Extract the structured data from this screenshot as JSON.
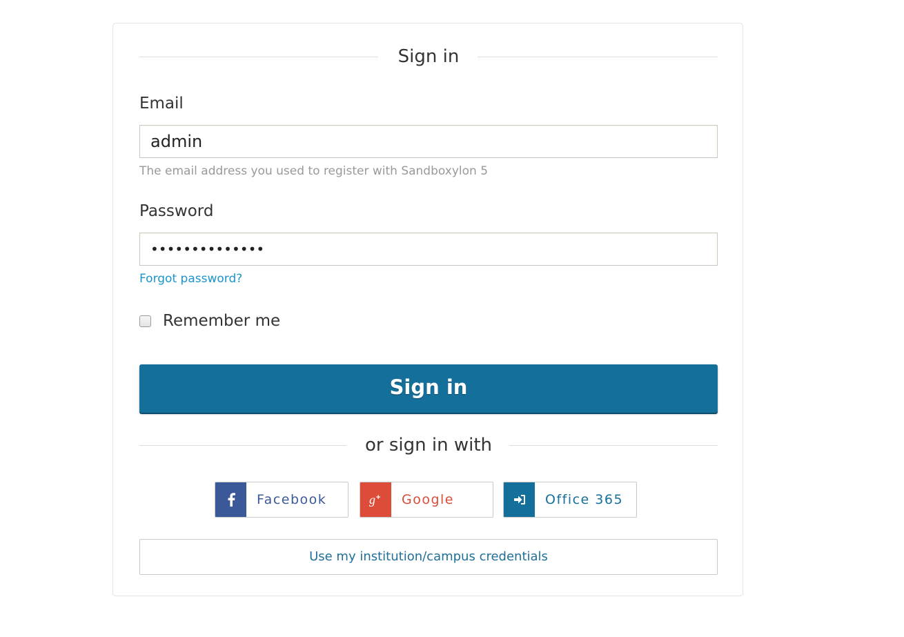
{
  "form": {
    "title": "Sign in",
    "email": {
      "label": "Email",
      "value": "admin",
      "help": "The email address you used to register with Sandboxylon 5"
    },
    "password": {
      "label": "Password",
      "value": "••••••••••••••",
      "forgot_link": "Forgot password?"
    },
    "remember": {
      "label": "Remember me",
      "checked": false
    },
    "submit_label": "Sign in",
    "alt_heading": "or sign in with",
    "social": [
      {
        "label": "Facebook",
        "icon": "facebook-icon",
        "color": "#3b5998",
        "text_color": "#3b5998"
      },
      {
        "label": "Google",
        "icon": "google-plus-icon",
        "color": "#dd4b39",
        "text_color": "#dd4b39"
      },
      {
        "label": "Office 365",
        "icon": "sign-in-icon",
        "color": "#156f9b",
        "text_color": "#156f9b"
      }
    ],
    "institution_label": "Use my institution/campus credentials"
  },
  "colors": {
    "primary": "#156f9b",
    "link": "#1a95cc",
    "help_text": "#999999"
  }
}
